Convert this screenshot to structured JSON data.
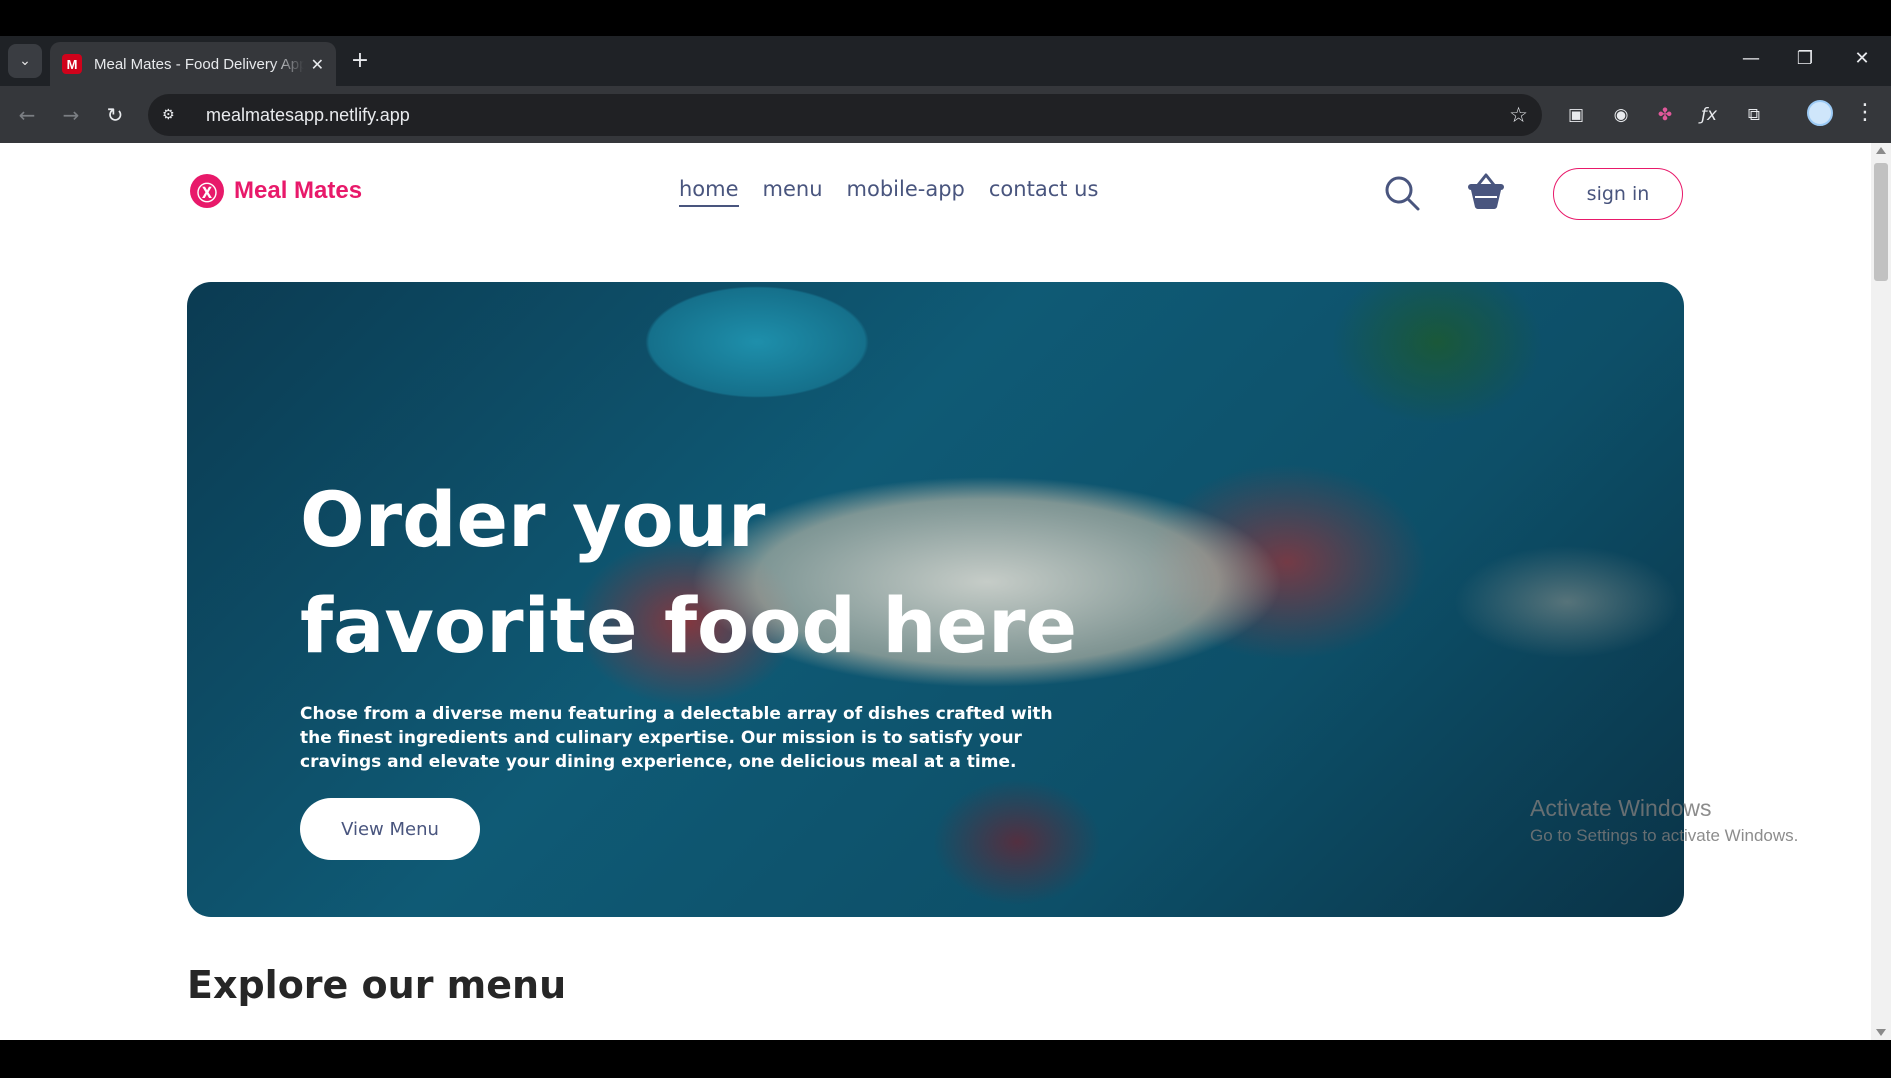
{
  "browser": {
    "tab_title": "Meal Mates - Food Delivery App",
    "favicon_letter": "M",
    "tab_close": "✕",
    "new_tab": "+",
    "url": "mealmatesapp.netlify.app",
    "window_controls": {
      "minimize": "—",
      "restore": "❐",
      "close": "✕"
    },
    "extensions": [
      "tab-search-icon",
      "screen-record-icon",
      "color-picker-icon",
      "fx-icon",
      "extensions-icon"
    ],
    "ext_glyphs": [
      "▣",
      "◉",
      "✤",
      "ƒx",
      "⧉"
    ]
  },
  "site": {
    "logo_mark": "Ⓧ",
    "logo_text": "Meal Mates",
    "nav": [
      "home",
      "menu",
      "mobile-app",
      "contact us"
    ],
    "active_nav": "home",
    "signin_label": "sign in",
    "brand_color": "#e8196a",
    "text_color": "#49557e"
  },
  "hero": {
    "title": "Order your favorite food here",
    "description": "Chose from a diverse menu featuring a delectable array of dishes crafted with the finest ingredients and culinary expertise. Our mission is to satisfy your cravings and elevate your dining experience, one delicious meal at a time.",
    "button_label": "View Menu"
  },
  "section": {
    "explore_title": "Explore our menu"
  },
  "os_watermark": {
    "title": "Activate Windows",
    "subtitle": "Go to Settings to activate Windows."
  }
}
